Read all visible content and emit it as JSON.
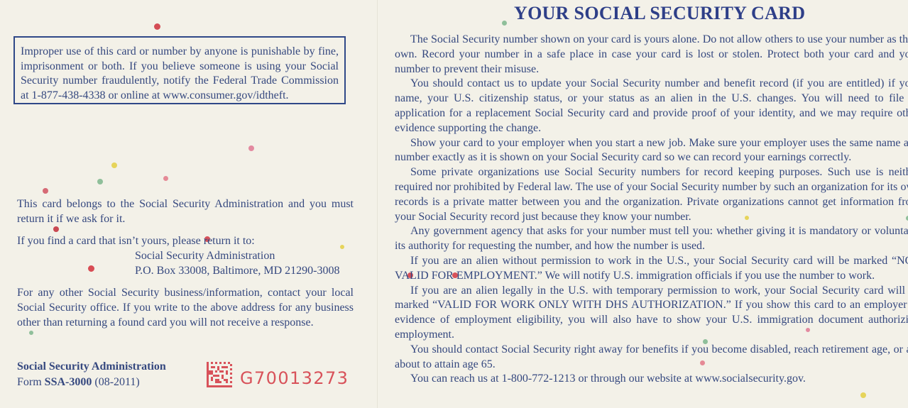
{
  "warning": "Improper use of this card or number by anyone is punishable by fine, imprisonment or both. If you believe someone is using your Social Security number fraudulently, notify the Federal Trade Commission at 1-877-438-4338 or online at www.consumer.gov/idtheft.",
  "left": {
    "belongs": "This card belongs to the Social Security Administration and you must return it if we ask for it.",
    "found_intro": "If you find a card that isn’t yours, please return it to:",
    "address_line1": "Social Security Administration",
    "address_line2": "P.O. Box 33008, Baltimore, MD 21290-3008",
    "other_business": "For any other Social Security business/information, contact your local Social Security office. If you write to the above address for any business other than returning a found card you will not receive a response.",
    "org": "Social Security Administration",
    "form_prefix": "Form ",
    "form_number": "SSA-3000",
    "form_date": " (08-2011)",
    "serial": "G70013273"
  },
  "right": {
    "title": "YOUR SOCIAL SECURITY CARD",
    "paragraphs": [
      "The Social Security number shown on your card is yours alone. Do not allow others to use your number as their own. Record your number in a safe place in case your card is lost or stolen. Protect both your card and your number to prevent their misuse.",
      "You should contact us to update your Social Security number and benefit record (if you are entitled) if your name, your U.S. citizenship status, or your status as an alien in the U.S. changes. You will need to file an application for a replacement Social Security card and provide proof of your identity, and we may require other evidence supporting the change.",
      "Show your card to your employer when you start a new job. Make sure your employer uses the same name and number exactly as it is shown on your Social Security card so we can record your earnings correctly.",
      "Some private organizations use Social Security numbers for record keeping purposes. Such use is neither required nor prohibited by Federal law. The use of your Social Security number by such an organization for its own records is a private matter between you and the organization. Private organizations cannot get information from your Social Security record just because they know your number.",
      "Any government agency that asks for your number must tell you: whether giving it is mandatory or voluntary, its authority for requesting the number, and how the number is used.",
      "If you are an alien without permission to work in the U.S., your Social Security card will be marked “NOT VALID FOR EMPLOYMENT.” We will notify U.S. immigration officials if you use the number to work.",
      "If you are an alien legally in the U.S. with temporary permission to work, your Social Security card will be marked “VALID FOR WORK ONLY WITH DHS AUTHORIZATION.” If you show this card to an employer as evidence of employment eligibility, you will also have to show your U.S. immigration document authorizing employment.",
      "You should contact Social Security right away for benefits if you become disabled, reach retirement age, or are about to attain age 65.",
      "You can reach us at 1-800-772-1213 or through our website at www.socialsecurity.gov."
    ]
  }
}
